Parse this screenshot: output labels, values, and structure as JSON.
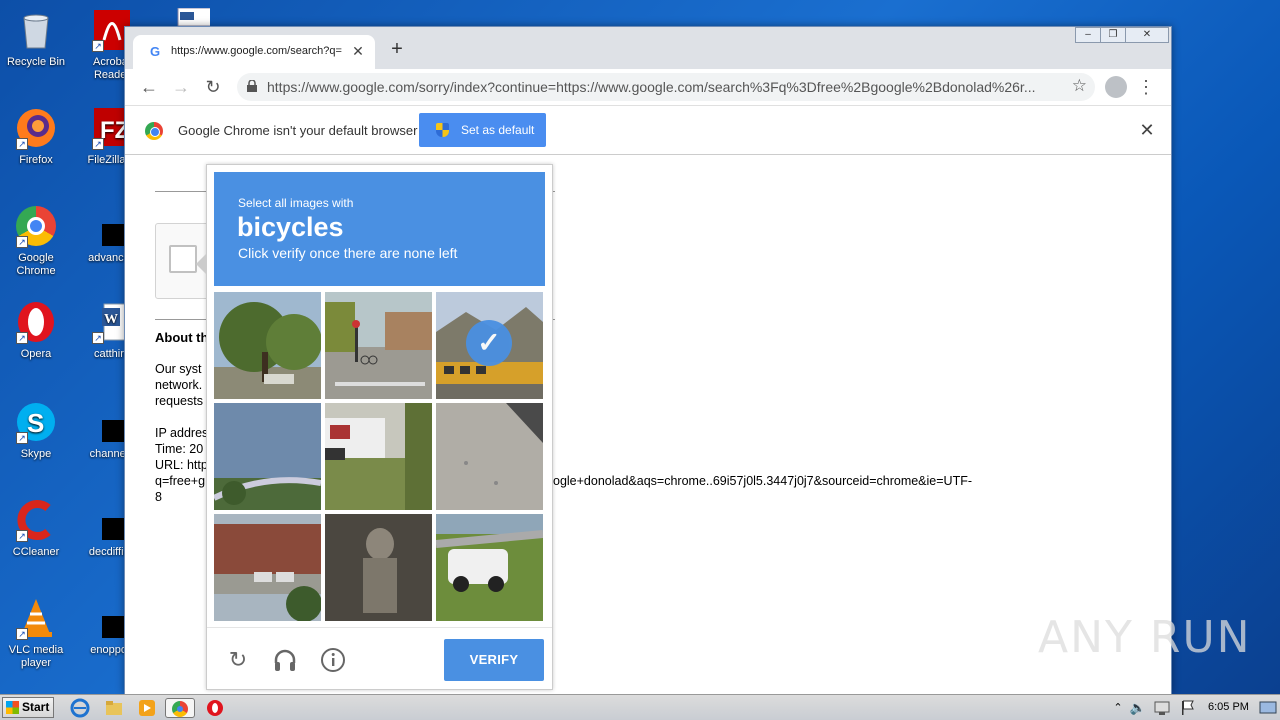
{
  "desktop": {
    "icons": [
      {
        "label": "Recycle Bin"
      },
      {
        "label": "Acrobat Reader"
      },
      {
        "label": "Firefox"
      },
      {
        "label": "FileZilla C"
      },
      {
        "label": "Google Chrome"
      },
      {
        "label": "advanced"
      },
      {
        "label": "Opera"
      },
      {
        "label": "catthird"
      },
      {
        "label": "Skype"
      },
      {
        "label": "channelri"
      },
      {
        "label": "CCleaner"
      },
      {
        "label": "decdifficu"
      },
      {
        "label": "VLC media player"
      },
      {
        "label": "enopport"
      }
    ]
  },
  "browser": {
    "tab_title": "https://www.google.com/search?q=",
    "tab_close": "✕",
    "new_tab": "+",
    "url": "https://www.google.com/sorry/index?continue=https://www.google.com/search%3Fq%3Dfree%2Bgoogle%2Bdonolad%26r...",
    "infobar_message": "Google Chrome isn't your default browser",
    "set_default_label": "Set as default"
  },
  "page": {
    "about_heading": "About th",
    "para1": [
      "Our syst",
      "network.",
      "requests"
    ],
    "ip_lines": [
      "IP addres",
      "Time: 20",
      "URL: http",
      "q=free+g",
      "8"
    ],
    "url_tail": "ogle+donolad&aqs=chrome..69i57j0l5.3447j0j7&sourceid=chrome&ie=UTF-"
  },
  "captcha": {
    "instruction_small": "Select all images with",
    "target": "bicycles",
    "instruction_tail": "Click verify once there are none left",
    "verify_label": "VERIFY",
    "tiles": [
      {
        "scene": "trees",
        "selected": false
      },
      {
        "scene": "street-crosswalk",
        "selected": false
      },
      {
        "scene": "school-bus",
        "selected": true
      },
      {
        "scene": "sky-bridge",
        "selected": false
      },
      {
        "scene": "house-lawn",
        "selected": false
      },
      {
        "scene": "pavement",
        "selected": false
      },
      {
        "scene": "motel",
        "selected": false
      },
      {
        "scene": "statue",
        "selected": false
      },
      {
        "scene": "white-suv",
        "selected": false
      }
    ]
  },
  "taskbar": {
    "start_label": "Start",
    "clock": "6:05 PM"
  },
  "watermark": "ANY RUN"
}
